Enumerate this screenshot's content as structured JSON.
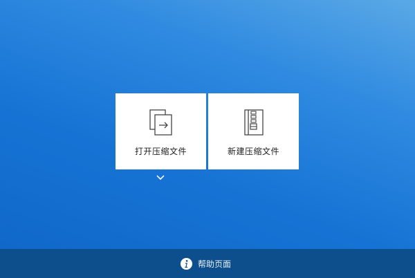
{
  "actions": {
    "open_archive_label": "打开压缩文件",
    "new_archive_label": "新建压缩文件"
  },
  "footer": {
    "help_label": "帮助页面"
  },
  "icons": {
    "open": "open-file-icon",
    "new": "zip-file-icon",
    "expand": "chevron-down-icon",
    "help": "info-icon"
  },
  "colors": {
    "background": "#1673d4",
    "footer": "#0d4f8d",
    "card": "#ffffff"
  }
}
